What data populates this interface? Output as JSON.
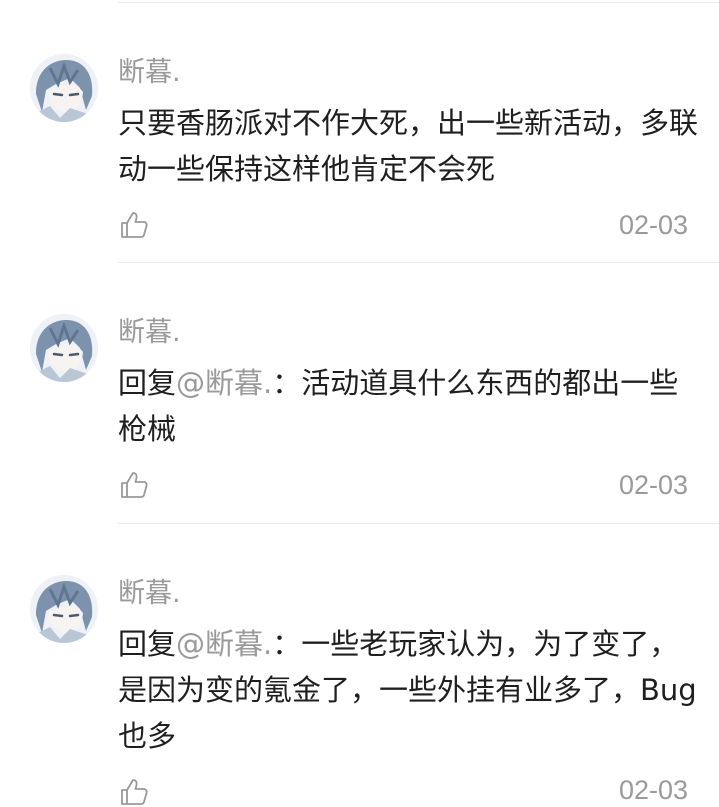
{
  "comments": [
    {
      "username": "断暮.",
      "reply_prefix": "",
      "reply_to": "",
      "text": "只要香肠派对不作大死，出一些新活动，多联动一些保持这样他肯定不会死",
      "date": "02-03",
      "like_icon": "thumbs-up-icon",
      "avatar_icon": "anime-avatar"
    },
    {
      "username": "断暮.",
      "reply_prefix": "回复",
      "reply_to": "@断暮.",
      "text": "：活动道具什么东西的都出一些枪械",
      "date": "02-03",
      "like_icon": "thumbs-up-icon",
      "avatar_icon": "anime-avatar"
    },
    {
      "username": "断暮.",
      "reply_prefix": "回复",
      "reply_to": "@断暮.",
      "text": "：一些老玩家认为，为了变了，是因为变的氪金了，一些外挂有业多了，Bug也多",
      "date": "02-03",
      "like_icon": "thumbs-up-icon",
      "avatar_icon": "anime-avatar"
    }
  ],
  "colors": {
    "text": "#1f1f1f",
    "muted": "#9a9a9a",
    "divider": "#ececec"
  }
}
